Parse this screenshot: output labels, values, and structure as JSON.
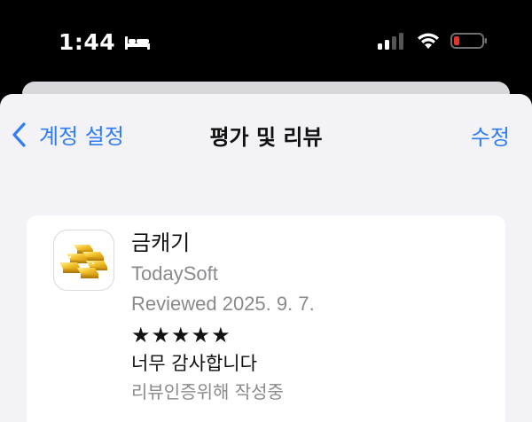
{
  "status_bar": {
    "time": "1:44",
    "icons": [
      "bed-icon",
      "cellular-signal-icon",
      "wifi-icon",
      "battery-low-icon"
    ],
    "battery_color": "#e5342b"
  },
  "nav": {
    "back_label": "계정 설정",
    "title": "평가 및 리뷰",
    "edit_label": "수정"
  },
  "review": {
    "app_icon": "gold-bars-icon",
    "app_name": "금캐기",
    "developer": "TodaySoft",
    "date": "Reviewed 2025. 9. 7.",
    "rating": 5,
    "stars_text": "★★★★★",
    "title": "너무 감사합니다",
    "status": "리뷰인증위해 작성중"
  },
  "colors": {
    "accent": "#2f7cf6",
    "background": "#f2f2f7",
    "card": "#ffffff",
    "secondary_text": "#8a8a8e"
  }
}
